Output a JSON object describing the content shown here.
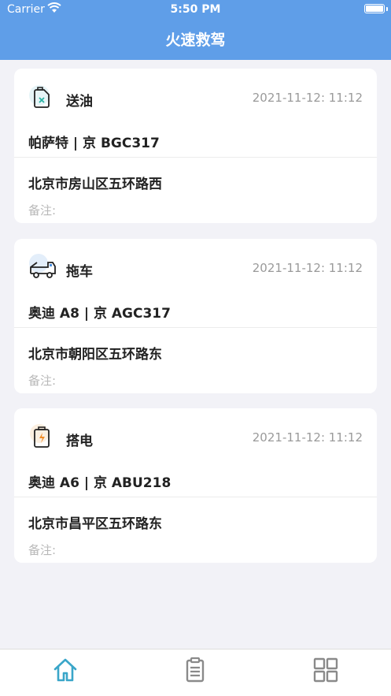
{
  "status": {
    "carrier": "Carrier",
    "time": "5:50 PM"
  },
  "header": {
    "title": "火速救驾"
  },
  "orders": [
    {
      "service": "送油",
      "icon": "fuel-can-icon",
      "time": "2021-11-12: 11:12",
      "vehicle": "帕萨特 | 京 BGC317",
      "address": "北京市房山区五环路西",
      "remark": "备注:"
    },
    {
      "service": "拖车",
      "icon": "tow-truck-icon",
      "time": "2021-11-12: 11:12",
      "vehicle": "奥迪 A8 | 京 AGC317",
      "address": "北京市朝阳区五环路东",
      "remark": "备注:"
    },
    {
      "service": "搭电",
      "icon": "battery-charge-icon",
      "time": "2021-11-12: 11:12",
      "vehicle": "奥迪 A6 | 京 ABU218",
      "address": "北京市昌平区五环路东",
      "remark": "备注:"
    }
  ],
  "tabbar": {
    "items": [
      "home-icon",
      "clipboard-icon",
      "grid-icon"
    ],
    "active_color": "#3aa6c9",
    "inactive_color": "#8a8a8a"
  },
  "colors": {
    "header": "#5f9ee8",
    "background": "#f2f2f7"
  }
}
